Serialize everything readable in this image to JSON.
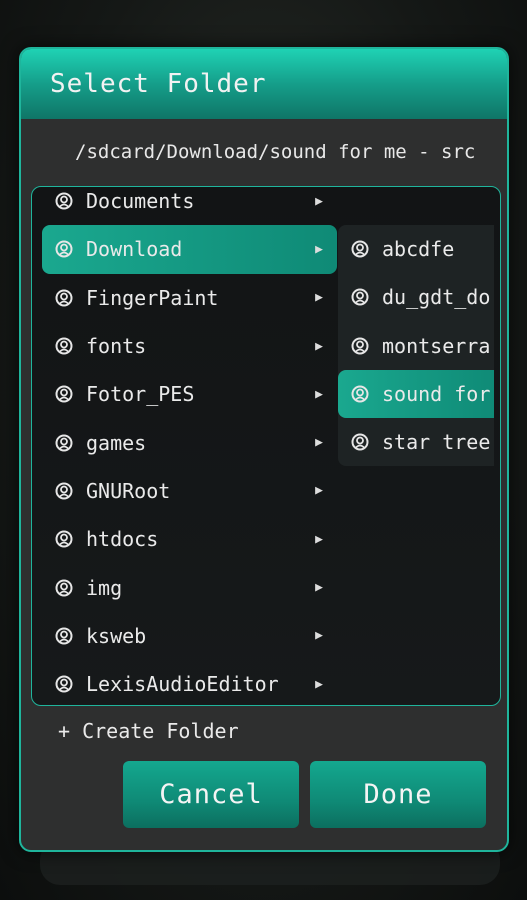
{
  "dialog": {
    "title": "Select Folder",
    "path": "/sdcard/Download/sound for me - src",
    "create_label": "+ Create Folder",
    "cancel_label": "Cancel",
    "done_label": "Done"
  },
  "folders": [
    {
      "label": "Documents",
      "selected": false
    },
    {
      "label": "Download",
      "selected": true
    },
    {
      "label": "FingerPaint",
      "selected": false
    },
    {
      "label": "fonts",
      "selected": false
    },
    {
      "label": "Fotor_PES",
      "selected": false
    },
    {
      "label": "games",
      "selected": false
    },
    {
      "label": "GNURoot",
      "selected": false
    },
    {
      "label": "htdocs",
      "selected": false
    },
    {
      "label": "img",
      "selected": false
    },
    {
      "label": "ksweb",
      "selected": false
    },
    {
      "label": "LexisAudioEditor",
      "selected": false
    }
  ],
  "subfolders": [
    {
      "label": "abcdfe",
      "selected": false
    },
    {
      "label": "du_gdt_do",
      "selected": false
    },
    {
      "label": "montserra",
      "selected": false
    },
    {
      "label": "sound for",
      "selected": true
    },
    {
      "label": "star tree",
      "selected": false
    }
  ],
  "colors": {
    "accent": "#1fb59c",
    "selected": "#14a88f"
  }
}
